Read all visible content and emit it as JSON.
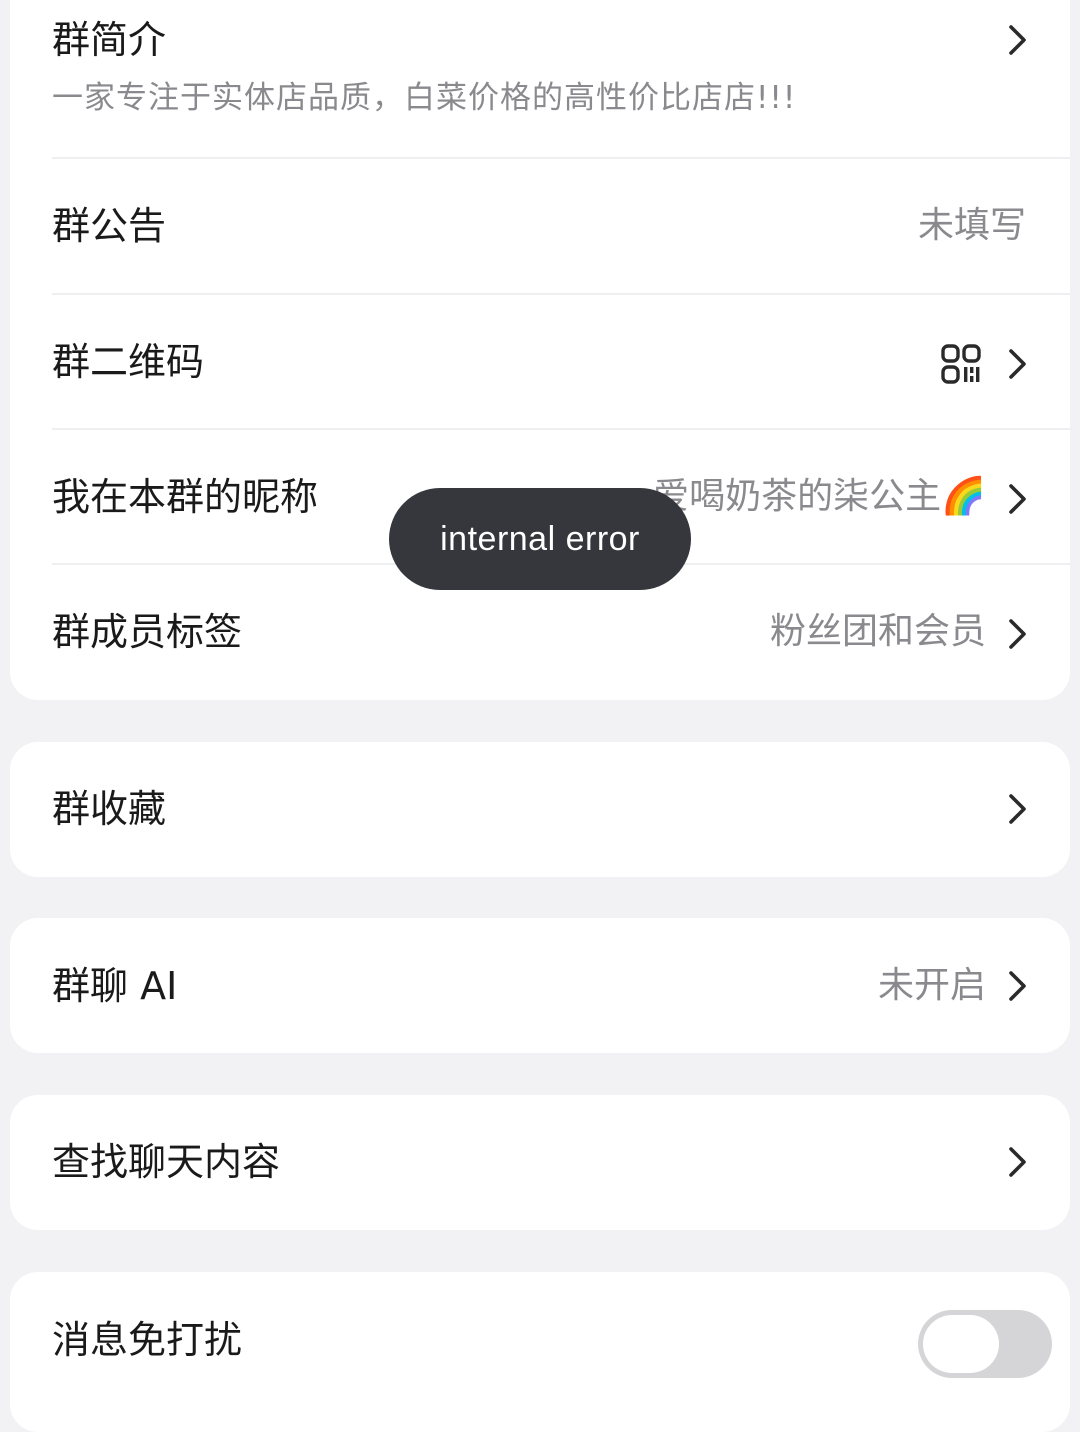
{
  "group_info": {
    "intro_label": "群简介",
    "intro_text": "一家专注于实体店品质，白菜价格的高性价比店店!!!",
    "announcement_label": "群公告",
    "announcement_value": "未填写",
    "qrcode_label": "群二维码",
    "nickname_label": "我在本群的昵称",
    "nickname_value": "爱喝奶茶的柒公主🌈",
    "member_tag_label": "群成员标签",
    "member_tag_value": "粉丝团和会员"
  },
  "favorites": {
    "label": "群收藏"
  },
  "ai": {
    "label": "群聊 AI",
    "value": "未开启"
  },
  "search": {
    "label": "查找聊天内容"
  },
  "mute": {
    "label": "消息免打扰",
    "enabled": false
  },
  "toast": {
    "message": "internal error"
  },
  "icons": {
    "chevron": "chevron-right-icon",
    "qrcode": "qrcode-icon"
  },
  "colors": {
    "background": "#f2f2f4",
    "card": "#ffffff",
    "secondary_text": "#8a8a8e",
    "toast_bg": "#35373d",
    "toggle_off": "#d5d5d8"
  }
}
